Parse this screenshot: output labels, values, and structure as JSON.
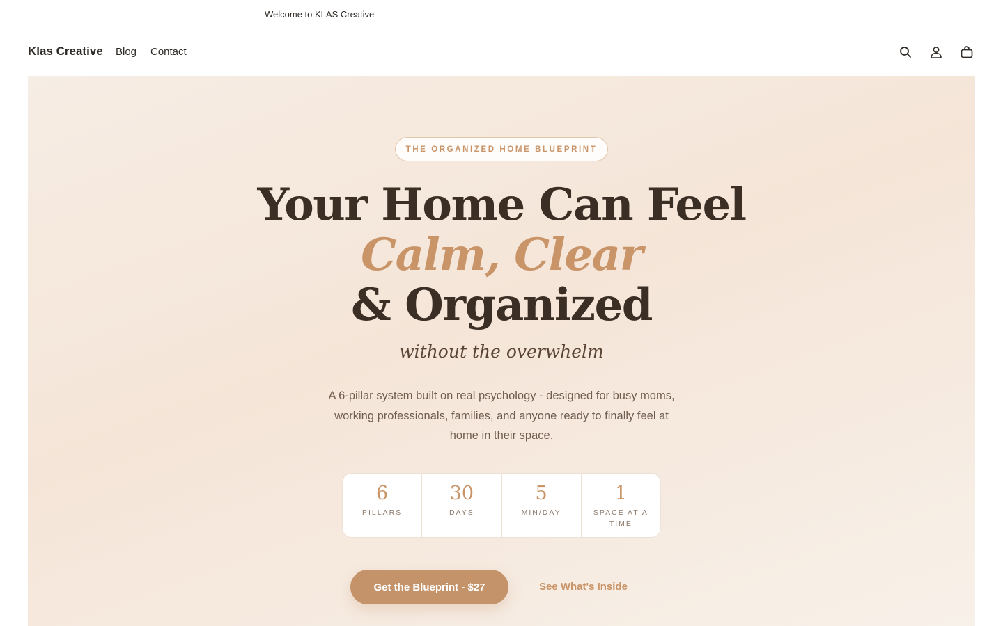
{
  "announcement": {
    "text": "Welcome to KLAS Creative"
  },
  "nav": {
    "logo": "Klas Creative",
    "links": [
      "Blog",
      "Contact"
    ],
    "icons": [
      "search-icon",
      "account-icon",
      "cart-icon"
    ]
  },
  "hero": {
    "eyebrow": "THE ORGANIZED HOME BLUEPRINT",
    "headline_line1": "Your Home Can Feel",
    "headline_line2": "Calm, Clear",
    "headline_line3": "& Organized",
    "tagline": "without the overwhelm",
    "description": "A 6-pillar system built on real psychology - designed for busy moms, working professionals, families, and anyone ready to finally feel at home in their space.",
    "stats": [
      {
        "value": "6",
        "label": "PILLARS"
      },
      {
        "value": "30",
        "label": "DAYS"
      },
      {
        "value": "5",
        "label": "MIN/DAY"
      },
      {
        "value": "1",
        "label": "SPACE AT A TIME"
      }
    ],
    "primary_cta": "Get the Blueprint - $27",
    "secondary_cta": "See What's Inside"
  },
  "colors": {
    "accent": "#c4936a",
    "heading": "#3b2e24",
    "hero_bg": "#f5e5d8"
  }
}
